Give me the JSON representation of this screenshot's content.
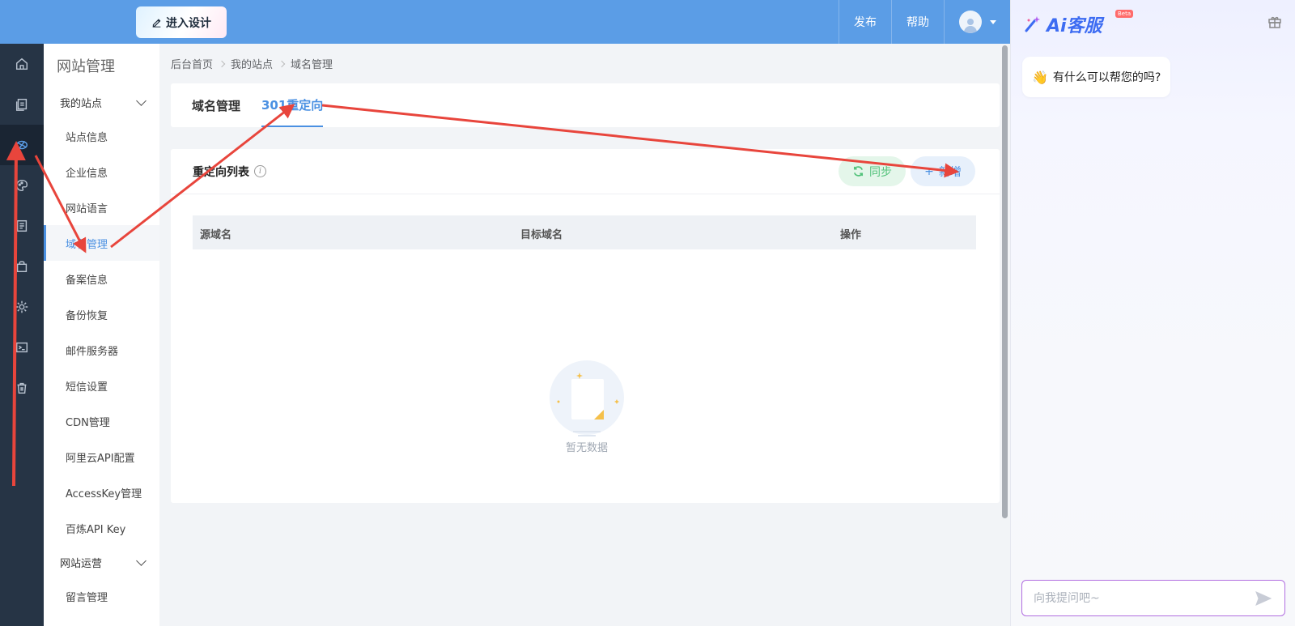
{
  "topbar": {
    "design_label": "进入设计",
    "publish_label": "发布",
    "help_label": "帮助"
  },
  "rail": {
    "items": [
      "home-icon",
      "pages-icon",
      "site-icon",
      "palette-icon",
      "document-icon",
      "bag-icon",
      "settings-icon",
      "terminal-icon",
      "trash-icon"
    ],
    "active_index": 2
  },
  "submenu": {
    "title": "网站管理",
    "group1_label": "我的站点",
    "items": [
      "站点信息",
      "企业信息",
      "网站语言",
      "域名管理",
      "备案信息",
      "备份恢复",
      "邮件服务器",
      "短信设置",
      "CDN管理",
      "阿里云API配置",
      "AccessKey管理",
      "百炼API Key"
    ],
    "active_item": "域名管理",
    "group2_label": "网站运营",
    "group2_items": [
      "留言管理"
    ]
  },
  "breadcrumb": [
    "后台首页",
    "我的站点",
    "域名管理"
  ],
  "tabs": [
    {
      "label": "域名管理",
      "active": false
    },
    {
      "label": "301重定向",
      "active": true
    }
  ],
  "list": {
    "title": "重定向列表",
    "info_icon": "i",
    "sync_label": "同步",
    "add_label": "新增",
    "add_prefix": "+",
    "columns": [
      "源域名",
      "目标域名",
      "操作"
    ],
    "empty_text": "暂无数据"
  },
  "ai": {
    "logo_text": "Ai客服",
    "beta_label": "Beta",
    "greeting": "有什么可以帮您的吗?",
    "greeting_emoji": "👋",
    "input_placeholder": "向我提问吧~"
  },
  "colors": {
    "topbar": "#5b9de6",
    "rail": "#263445",
    "accent": "#4a90e2",
    "sync": "#52c27a",
    "annotation": "#e8453c"
  }
}
